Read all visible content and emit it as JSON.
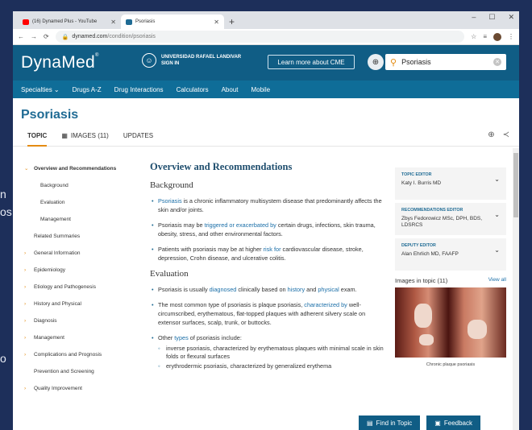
{
  "browser": {
    "tabs": [
      {
        "label": "(16) Dynamed Plus - YouTube",
        "fav_color": "#ff0000"
      },
      {
        "label": "Psoriasis",
        "fav_color": "#1f6b94"
      }
    ],
    "url_host": "dynamed.com",
    "url_path": "/condition/psoriasis"
  },
  "header": {
    "logo": "DynaMed",
    "institution": "UNIVERSIDAD RAFAEL LANDIVAR",
    "sign_in": "SIGN IN",
    "cme_button": "Learn more about CME",
    "search_value": "Psoriasis"
  },
  "nav": [
    "Specialties ⌄",
    "Drugs A-Z",
    "Drug Interactions",
    "Calculators",
    "About",
    "Mobile"
  ],
  "page": {
    "title": "Psoriasis",
    "tabs": [
      "TOPIC",
      "IMAGES (11)",
      "UPDATES"
    ]
  },
  "sidebar": {
    "active": "Overview and Recommendations",
    "sub": [
      "Background",
      "Evaluation",
      "Management"
    ],
    "related": "Related Summaries",
    "items": [
      "General Information",
      "Epidemiology",
      "Etiology and Pathogenesis",
      "History and Physical",
      "Diagnosis",
      "Management",
      "Complications and Prognosis",
      "Prevention and Screening",
      "Quality Improvement"
    ]
  },
  "main": {
    "heading": "Overview and Recommendations",
    "background_title": "Background",
    "b1_link": "Psoriasis",
    "b1_text": " is a chronic inflammatory multisystem disease that predominantly affects the skin and/or joints.",
    "b2_pre": "Psoriasis may be ",
    "b2_link": "triggered or exacerbated by",
    "b2_post": " certain drugs, infections, skin trauma, obesity, stress, and other environmental factors.",
    "b3_pre": "Patients with psoriasis may be at higher ",
    "b3_link": "risk for",
    "b3_post": " cardiovascular disease, stroke, depression, Crohn disease, and ulcerative colitis.",
    "evaluation_title": "Evaluation",
    "e1_pre": "Psoriasis is usually ",
    "e1_link1": "diagnosed",
    "e1_mid": " clinically based on ",
    "e1_link2": "history",
    "e1_and": " and ",
    "e1_link3": "physical",
    "e1_post": " exam.",
    "e2_pre": "The most common type of psoriasis is plaque psoriasis, ",
    "e2_link": "characterized by",
    "e2_post": " well-circumscribed, erythematous, flat-topped plaques with adherent silvery scale on extensor surfaces, scalp, trunk, or buttocks.",
    "e3_pre": "Other ",
    "e3_link": "types",
    "e3_post": " of psoriasis include:",
    "s1": "inverse psoriasis, characterized by erythematous plaques with minimal scale in skin folds or flexural surfaces",
    "s2": "erythrodermic psoriasis, characterized by generalized erythema"
  },
  "right_panel": {
    "editors": [
      {
        "label": "TOPIC EDITOR",
        "name": "Katy I. Burris MD"
      },
      {
        "label": "RECOMMENDATIONS EDITOR",
        "name": "Zbys Fedorowicz MSc, DPH, BDS, LDSRCS"
      },
      {
        "label": "DEPUTY EDITOR",
        "name": "Alan Ehrlich MD, FAAFP"
      }
    ],
    "images_title": "Images in topic (11)",
    "view_all": "View all",
    "caption": "Chronic plaque psoriasis"
  },
  "footer": {
    "find": "Find in Topic",
    "feedback": "Feedback"
  },
  "background_slide": {
    "left_lines": [
      "n",
      "os"
    ],
    "left_bottom": "o"
  }
}
